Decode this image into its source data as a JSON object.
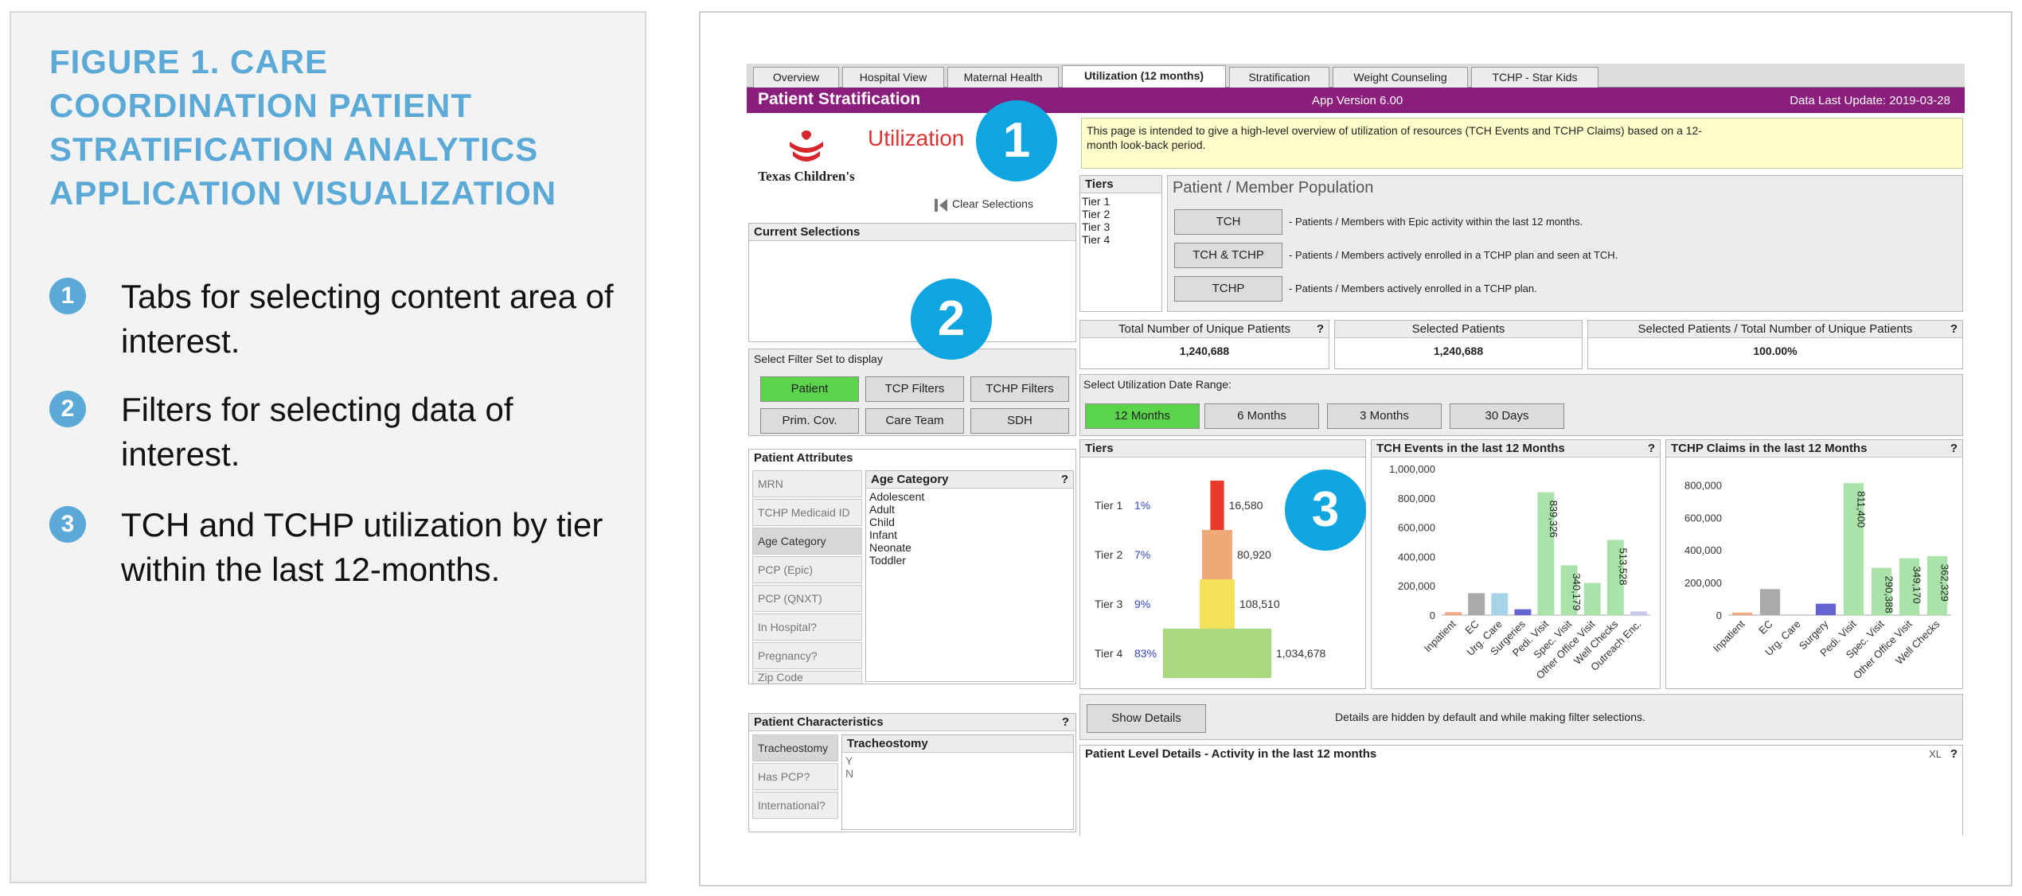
{
  "figure": {
    "title": "FIGURE 1. CARE COORDINATION PATIENT STRATIFICATION ANALYTICS APPLICATION VISUALIZATION",
    "legend": [
      {
        "num": "1",
        "text": "Tabs for selecting content area of interest."
      },
      {
        "num": "2",
        "text": "Filters for selecting data of interest."
      },
      {
        "num": "3",
        "text": "TCH and TCHP utilization by tier within the last 12-months."
      }
    ]
  },
  "tabs": [
    "Overview",
    "Hospital View",
    "Maternal Health",
    "Utilization (12 months)",
    "Stratification",
    "Weight Counseling",
    "TCHP - Star Kids"
  ],
  "active_tab": "Utilization (12 months)",
  "titlebar": {
    "title": "Patient Stratification",
    "version": "App Version 6.00",
    "last_update": "Data Last Update:  2019-03-28"
  },
  "logo": {
    "text": "Texas Children's"
  },
  "page_label": "Utilization",
  "info_text": "This page is intended to give a high-level overview of utilization of resources (TCH Events and TCHP Claims) based on a 12-month look-back period.",
  "clear_selections": "Clear Selections",
  "current_selections": "Current Selections",
  "filter_set": {
    "label": "Select Filter Set to display",
    "buttons": [
      "Patient",
      "TCP Filters",
      "TCHP Filters",
      "Prim. Cov.",
      "Care Team",
      "SDH"
    ]
  },
  "patient_attributes": {
    "title": "Patient Attributes",
    "items": [
      "MRN",
      "TCHP Medicaid ID",
      "Age Category",
      "PCP (Epic)",
      "PCP (QNXT)",
      "In Hospital?",
      "Pregnancy?",
      "Zip Code"
    ],
    "list_title": "Age Category",
    "list": [
      "Adolescent",
      "Adult",
      "Child",
      "Infant",
      "Neonate",
      "Toddler"
    ]
  },
  "patient_characteristics": {
    "title": "Patient Characteristics",
    "items": [
      "Tracheostomy",
      "Has PCP?",
      "International?"
    ],
    "list_title": "Tracheostomy",
    "list": [
      "Y",
      "N"
    ]
  },
  "tiers_box": {
    "title": "Tiers",
    "items": [
      "Tier 1",
      "Tier 2",
      "Tier 3",
      "Tier 4"
    ]
  },
  "population": {
    "title": "Patient / Member Population",
    "rows": [
      {
        "button": "TCH",
        "desc": "- Patients / Members with Epic activity within the last 12 months."
      },
      {
        "button": "TCH & TCHP",
        "desc": "- Patients / Members actively enrolled in a TCHP plan and seen at TCH."
      },
      {
        "button": "TCHP",
        "desc": "- Patients / Members actively enrolled in a TCHP plan."
      }
    ]
  },
  "kpis": [
    {
      "label": "Total Number of Unique Patients",
      "value": "1,240,688"
    },
    {
      "label": "Selected Patients",
      "value": "1,240,688"
    },
    {
      "label": "Selected Patients / Total Number of Unique Patients",
      "value": "100.00%"
    }
  ],
  "date_range": {
    "label": "Select Utilization Date Range:",
    "buttons": [
      "12 Months",
      "6 Months",
      "3 Months",
      "30 Days"
    ]
  },
  "qmark": "?",
  "details": {
    "button": "Show Details",
    "note": "Details are hidden by default and while making filter selections.",
    "section": "Patient Level Details - Activity in the last 12 months",
    "xl": "XL"
  },
  "badges": [
    "1",
    "2",
    "3"
  ],
  "chart_data": [
    {
      "type": "bar",
      "title": "Tiers",
      "categories": [
        "Tier 1",
        "Tier 2",
        "Tier 3",
        "Tier 4"
      ],
      "percents": [
        "1%",
        "7%",
        "9%",
        "83%"
      ],
      "values": [
        16580,
        80920,
        108510,
        1034678
      ],
      "value_labels": [
        "16,580",
        "80,920",
        "108,510",
        "1,034,678"
      ],
      "colors": [
        "#e83b2a",
        "#f0a878",
        "#f5e05a",
        "#a8d880"
      ]
    },
    {
      "type": "bar",
      "title": "TCH Events in the last 12 Months",
      "categories": [
        "Inpatient",
        "EC",
        "Urg. Care",
        "Surgeries",
        "Pedi. Visit",
        "Spec. Visit",
        "Other Office Visit",
        "Well Checks",
        "Outreach Enc."
      ],
      "values": [
        20000,
        150000,
        150000,
        40000,
        839326,
        340179,
        220000,
        513528,
        25000
      ],
      "value_labels": [
        "",
        "",
        "",
        "",
        "839,326",
        "340,179",
        "",
        "513,528",
        ""
      ],
      "colors": [
        "#f4a582",
        "#aaaaaa",
        "#a7d3e8",
        "#6464d2",
        "#a9e3a9",
        "#a9e3a9",
        "#a9e3a9",
        "#a9e3a9",
        "#c9c9f0"
      ],
      "ylim": [
        0,
        1000000
      ],
      "yticks": [
        "1,000,000",
        "800,000",
        "600,000",
        "400,000",
        "200,000",
        "0"
      ]
    },
    {
      "type": "bar",
      "title": "TCHP Claims in the last 12 Months",
      "categories": [
        "Inpatient",
        "EC",
        "Urg. Care",
        "Surgery",
        "Pedi. Visit",
        "Spec. Visit",
        "Other Office Visit",
        "Well Checks"
      ],
      "values": [
        15000,
        160000,
        5000,
        70000,
        811400,
        290388,
        349170,
        362329
      ],
      "value_labels": [
        "",
        "",
        "",
        "",
        "811,400",
        "290,388",
        "349,170",
        "362,329"
      ],
      "colors": [
        "#f4a582",
        "#aaaaaa",
        "#cccccc",
        "#6464d2",
        "#a9e3a9",
        "#a9e3a9",
        "#a9e3a9",
        "#a9e3a9"
      ],
      "ylim": [
        0,
        900000
      ],
      "yticks": [
        "800,000",
        "600,000",
        "400,000",
        "200,000",
        "0"
      ]
    }
  ]
}
